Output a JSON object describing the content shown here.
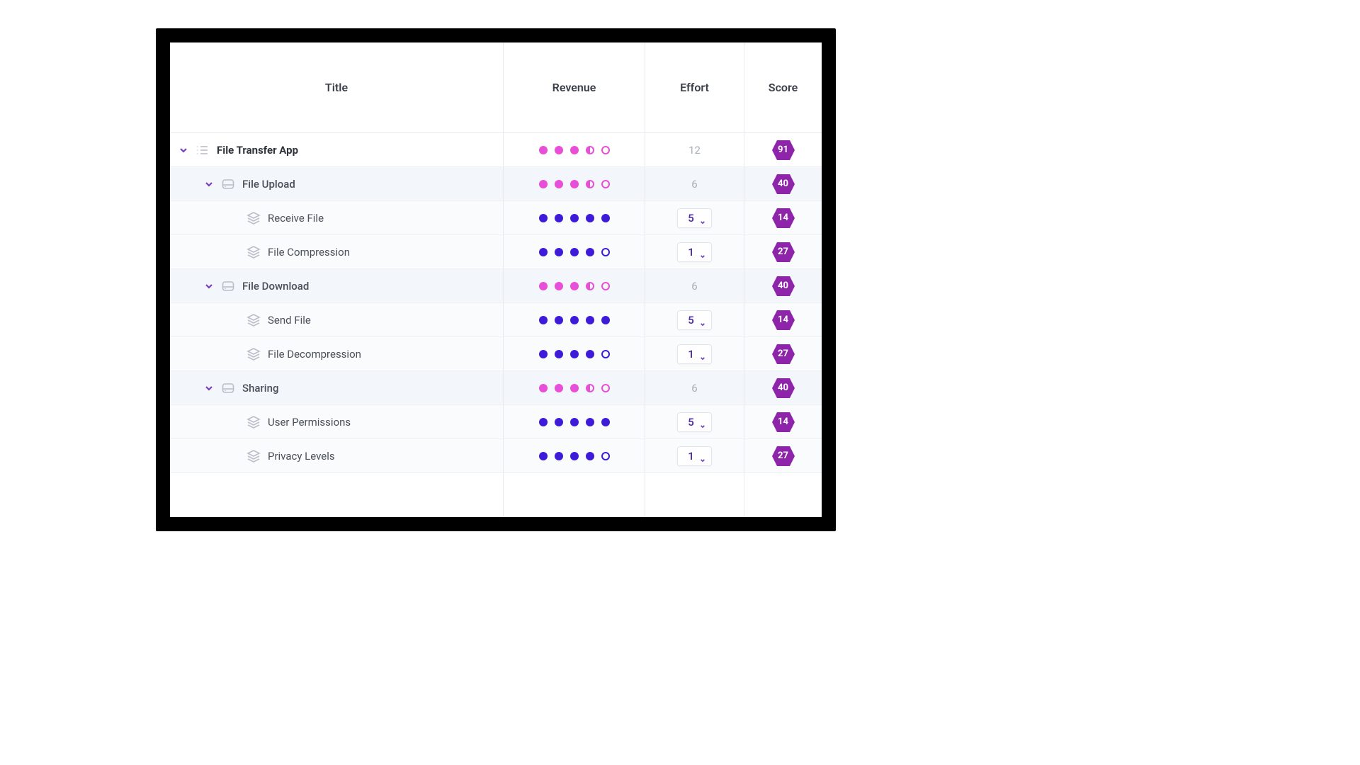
{
  "columns": {
    "title": "Title",
    "revenue": "Revenue",
    "effort": "Effort",
    "score": "Score"
  },
  "colors": {
    "pink": "#e84fd8",
    "blue": "#3e1bd9",
    "hex": "#8e24aa",
    "chevron": "#7b3fbf"
  },
  "rows": [
    {
      "level": 0,
      "icon": "list",
      "expanded": true,
      "title": "File Transfer App",
      "revenue": {
        "color": "pink",
        "fill": 3,
        "half": true,
        "empty": 1
      },
      "effort": {
        "type": "text",
        "value": "12"
      },
      "score": "91"
    },
    {
      "level": 1,
      "icon": "drive",
      "expanded": true,
      "title": "File Upload",
      "revenue": {
        "color": "pink",
        "fill": 3,
        "half": true,
        "empty": 1
      },
      "effort": {
        "type": "text",
        "value": "6"
      },
      "score": "40"
    },
    {
      "level": 2,
      "icon": "stack",
      "expanded": false,
      "title": "Receive File",
      "revenue": {
        "color": "blue",
        "fill": 5,
        "half": false,
        "empty": 0
      },
      "effort": {
        "type": "select",
        "value": "5"
      },
      "score": "14"
    },
    {
      "level": 2,
      "icon": "stack",
      "expanded": false,
      "title": "File Compression",
      "revenue": {
        "color": "blue",
        "fill": 4,
        "half": false,
        "empty": 1
      },
      "effort": {
        "type": "select",
        "value": "1"
      },
      "score": "27"
    },
    {
      "level": 1,
      "icon": "drive",
      "expanded": true,
      "title": "File Download",
      "revenue": {
        "color": "pink",
        "fill": 3,
        "half": true,
        "empty": 1
      },
      "effort": {
        "type": "text",
        "value": "6"
      },
      "score": "40"
    },
    {
      "level": 2,
      "icon": "stack",
      "expanded": false,
      "title": "Send File",
      "revenue": {
        "color": "blue",
        "fill": 5,
        "half": false,
        "empty": 0
      },
      "effort": {
        "type": "select",
        "value": "5"
      },
      "score": "14"
    },
    {
      "level": 2,
      "icon": "stack",
      "expanded": false,
      "title": "File Decompression",
      "revenue": {
        "color": "blue",
        "fill": 4,
        "half": false,
        "empty": 1
      },
      "effort": {
        "type": "select",
        "value": "1"
      },
      "score": "27"
    },
    {
      "level": 1,
      "icon": "drive",
      "expanded": true,
      "title": "Sharing",
      "revenue": {
        "color": "pink",
        "fill": 3,
        "half": true,
        "empty": 1
      },
      "effort": {
        "type": "text",
        "value": "6"
      },
      "score": "40"
    },
    {
      "level": 2,
      "icon": "stack",
      "expanded": false,
      "title": "User Permissions",
      "revenue": {
        "color": "blue",
        "fill": 5,
        "half": false,
        "empty": 0
      },
      "effort": {
        "type": "select",
        "value": "5"
      },
      "score": "14"
    },
    {
      "level": 2,
      "icon": "stack",
      "expanded": false,
      "title": "Privacy Levels",
      "revenue": {
        "color": "blue",
        "fill": 4,
        "half": false,
        "empty": 1
      },
      "effort": {
        "type": "select",
        "value": "1"
      },
      "score": "27"
    }
  ]
}
